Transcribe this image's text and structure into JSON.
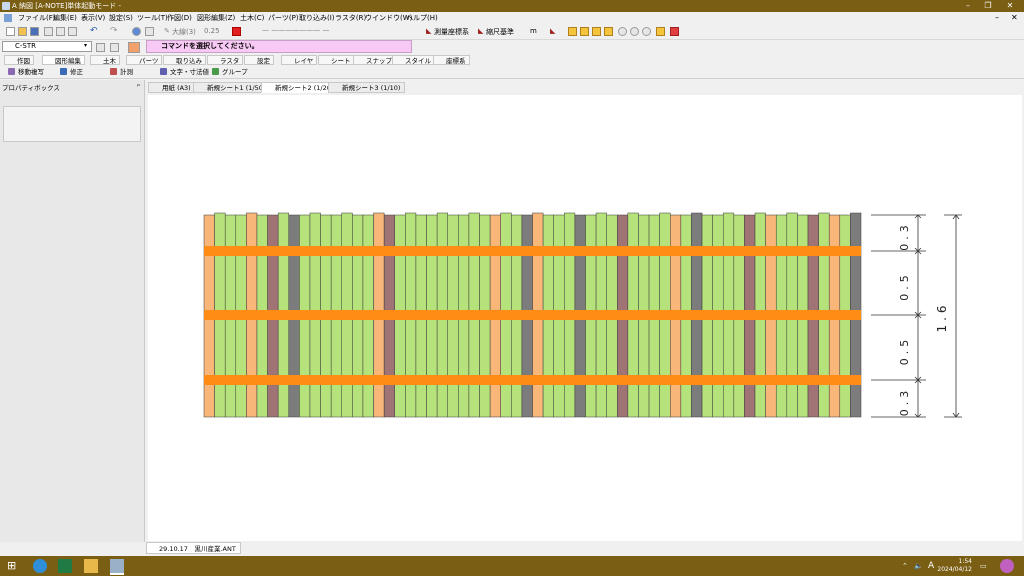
{
  "window": {
    "title": "A 納図 [A-NOTE]単体起動モード -"
  },
  "menu": [
    "ファイル(F)",
    "編集(E)",
    "表示(V)",
    "設定(S)",
    "ツール(T)",
    "作図(D)",
    "図形編集(Z)",
    "土木(C)",
    "パーツ(P)",
    "取り込み(I)",
    "ラスタ(R)",
    "ウインドウ(W)",
    "ヘルプ(H)"
  ],
  "toolbar": {
    "line_type": "大線(3)",
    "line_width": "0.25",
    "coord_label": "測量座標系",
    "scale_label": "縮尺基準",
    "unit": "m"
  },
  "layer_combo": "C-STR",
  "command_prompt": "コマンドを選択してください。",
  "ribbon_tabs": [
    "作図",
    "図形編集",
    "土木",
    "パーツ",
    "取り込み",
    "ラスタ",
    "設定",
    "レイヤ",
    "シート",
    "スナップ",
    "スタイル",
    "座標系"
  ],
  "ribbon_sub": [
    "移動複写",
    "修正",
    "計測",
    "文字・寸法値",
    "グループ"
  ],
  "panel": {
    "title": "プロパティボックス",
    "pin": "ᵖ"
  },
  "sheet_tabs": [
    "用紙 (A3)",
    "新規シート1 (1/50)",
    "新規シート2 (1/20)",
    "新規シート3 (1/10)"
  ],
  "active_sheet": 2,
  "drawing": {
    "colors": {
      "green": "#b5e27a",
      "orange": "#ff8c14",
      "peach": "#f8b679",
      "mauve": "#a07474",
      "gray": "#7c7c7c"
    },
    "dimensions": [
      "0.3",
      "0.5",
      "0.5",
      "0.3"
    ],
    "total_dimension": "1.6"
  },
  "document_tab": "29.10.17　黒川産業.ANT",
  "taskbar": {
    "ime": "A",
    "time": "1:54",
    "date": "2024/04/12"
  }
}
